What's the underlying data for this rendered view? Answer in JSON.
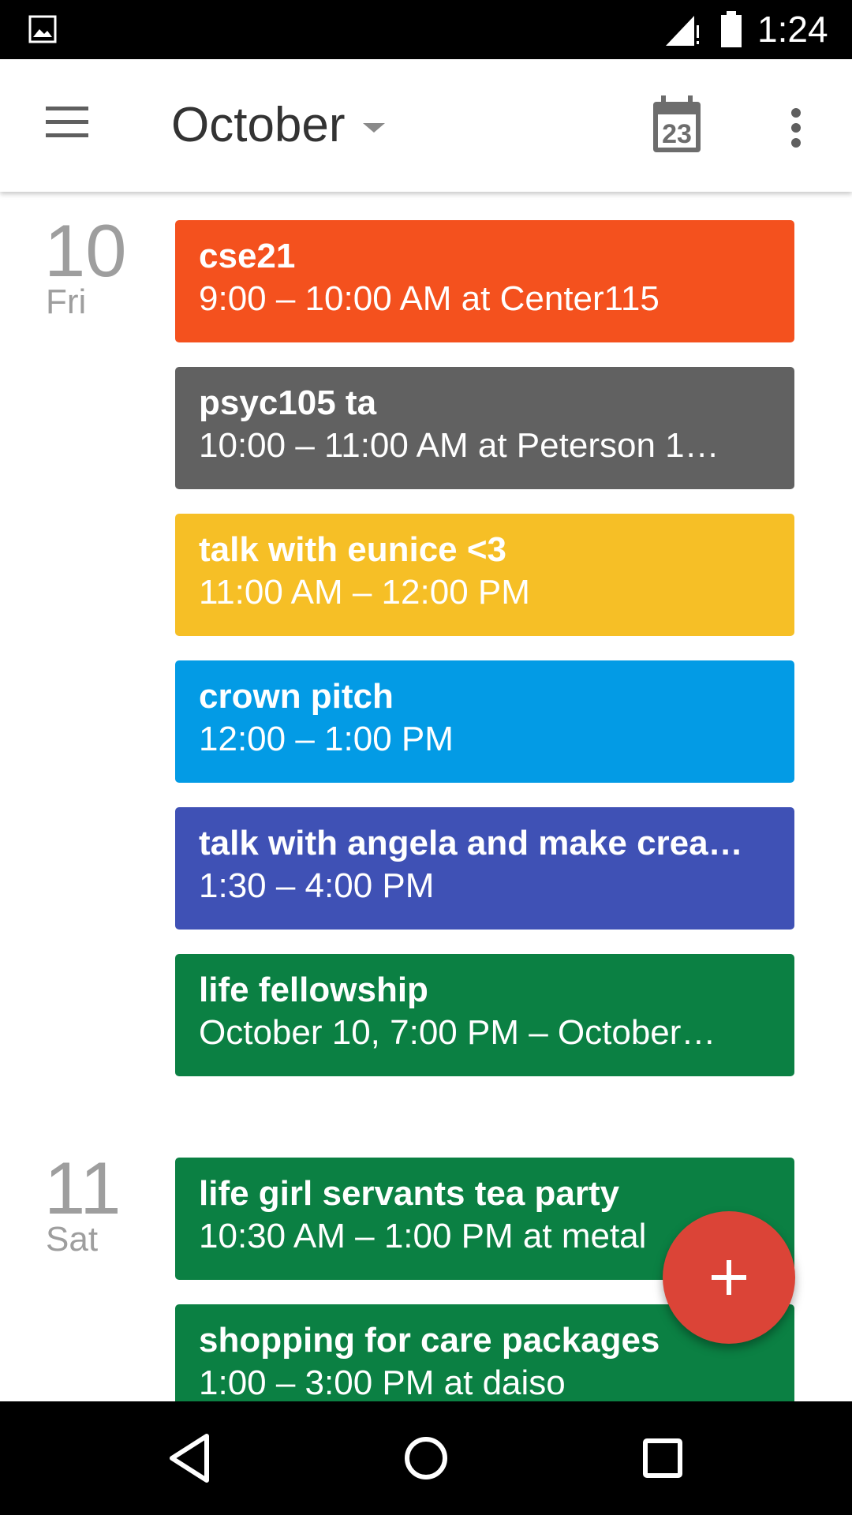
{
  "status_bar": {
    "time": "1:24",
    "icons": [
      "image-notification-icon",
      "signal-icon",
      "battery-icon"
    ]
  },
  "app_bar": {
    "title": "October",
    "today_icon_number": "23",
    "icons": [
      "menu-icon",
      "dropdown-caret-icon",
      "today-calendar-icon",
      "more-vert-icon"
    ]
  },
  "days": [
    {
      "number": "10",
      "name": "Fri",
      "events": [
        {
          "title": "cse21",
          "time": "9:00 – 10:00 AM at Center115",
          "color": "#f4511e"
        },
        {
          "title": "psyc105 ta",
          "time": "10:00 – 11:00 AM at Peterson 1…",
          "color": "#616161"
        },
        {
          "title": "talk with eunice <3",
          "time": "11:00 AM – 12:00 PM",
          "color": "#f6bf26"
        },
        {
          "title": "crown pitch",
          "time": "12:00 – 1:00 PM",
          "color": "#039be5"
        },
        {
          "title": "talk with angela and make crea…",
          "time": "1:30 – 4:00 PM",
          "color": "#3f51b5"
        },
        {
          "title": "life fellowship",
          "time": "October 10, 7:00 PM – October…",
          "color": "#0b8043"
        }
      ]
    },
    {
      "number": "11",
      "name": "Sat",
      "events": [
        {
          "title": "life girl servants tea party",
          "time": "10:30 AM – 1:00 PM at metal",
          "color": "#0b8043"
        },
        {
          "title": "shopping for care packages",
          "time": "1:00 – 3:00 PM at daiso",
          "color": "#0b8043"
        }
      ]
    }
  ],
  "fab": {
    "icon": "add-icon",
    "color": "#db4437"
  },
  "nav_bar": {
    "icons": [
      "back-icon",
      "home-icon",
      "recents-icon"
    ]
  }
}
